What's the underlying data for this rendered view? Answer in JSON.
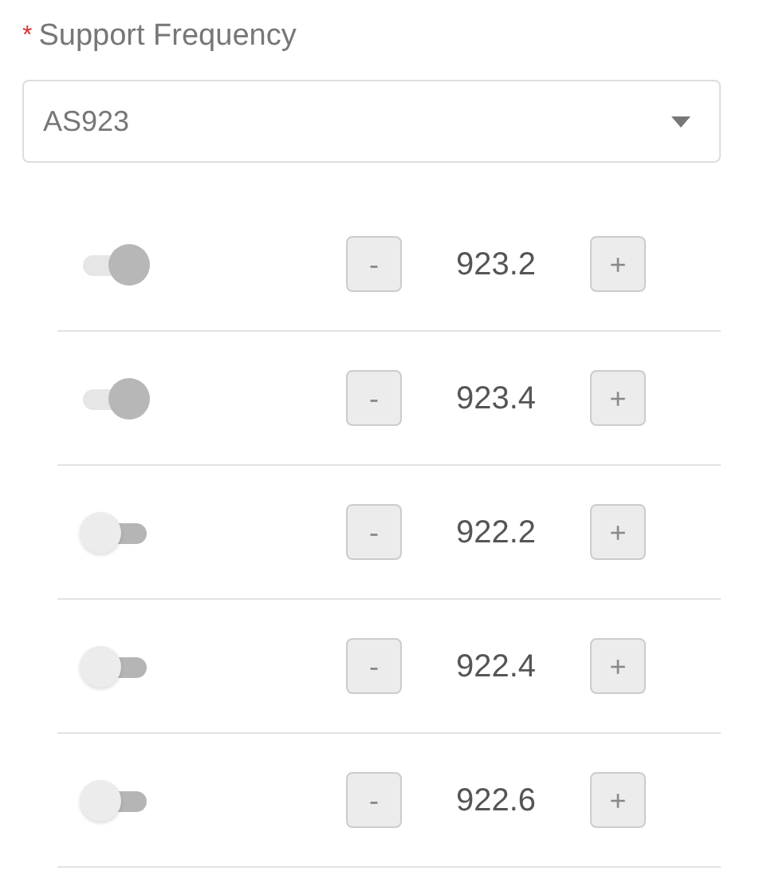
{
  "field": {
    "required_mark": "*",
    "label": "Support Frequency",
    "value": "AS923"
  },
  "channels": [
    {
      "on": true,
      "minus": "-",
      "value": "923.2",
      "plus": "+"
    },
    {
      "on": true,
      "minus": "-",
      "value": "923.4",
      "plus": "+"
    },
    {
      "on": false,
      "minus": "-",
      "value": "922.2",
      "plus": "+"
    },
    {
      "on": false,
      "minus": "-",
      "value": "922.4",
      "plus": "+"
    },
    {
      "on": false,
      "minus": "-",
      "value": "922.6",
      "plus": "+"
    }
  ]
}
